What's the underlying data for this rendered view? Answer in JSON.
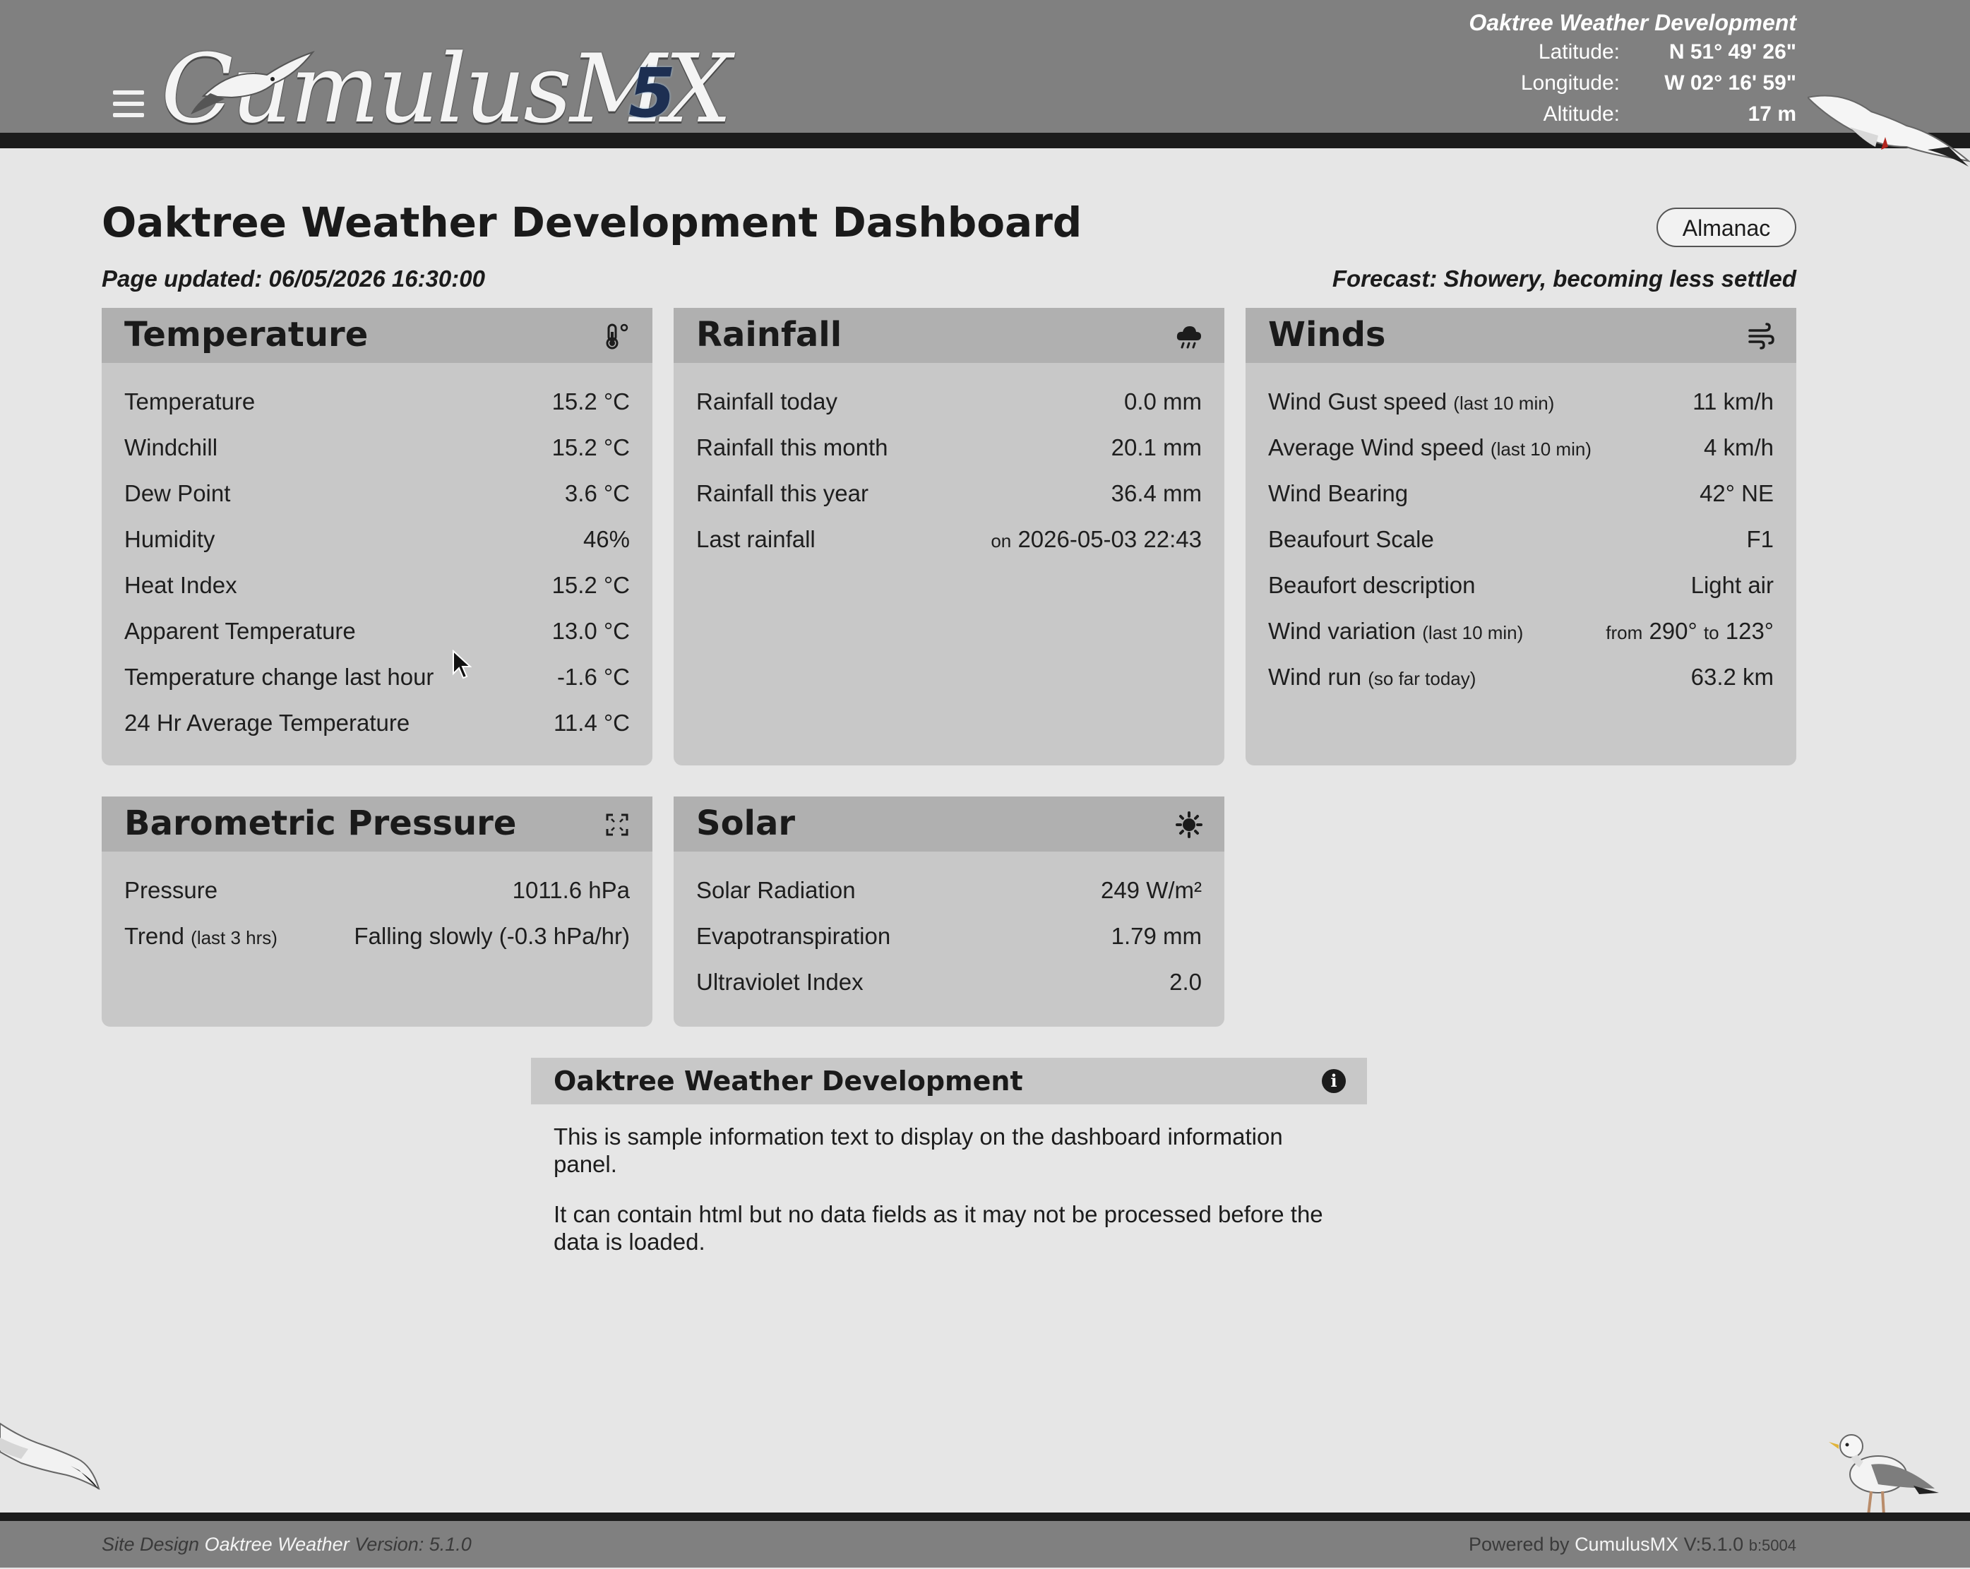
{
  "header": {
    "logo_text": "CumulusMX",
    "logo_version": "5",
    "station_name": "Oaktree Weather Development",
    "location": [
      {
        "label": "Latitude:",
        "value": "N 51° 49' 26\""
      },
      {
        "label": "Longitude:",
        "value": "W 02° 16' 59\""
      },
      {
        "label": "Altitude:",
        "value": "17 m"
      }
    ]
  },
  "page": {
    "title": "Oaktree Weather Development Dashboard",
    "almanac_button": "Almanac",
    "updated": "Page updated: 06/05/2026 16:30:00",
    "forecast": "Forecast: Showery, becoming less settled"
  },
  "temperature": {
    "title": "Temperature",
    "icon": "thermometer-icon",
    "rows": [
      {
        "label": "Temperature",
        "value": "15.2 °C"
      },
      {
        "label": "Windchill",
        "value": "15.2 °C"
      },
      {
        "label": "Dew Point",
        "value": "3.6 °C"
      },
      {
        "label": "Humidity",
        "value": "46%"
      },
      {
        "label": "Heat Index",
        "value": "15.2 °C"
      },
      {
        "label": "Apparent Temperature",
        "value": "13.0 °C"
      },
      {
        "label": "Temperature change last hour",
        "value": "-1.6 °C"
      },
      {
        "label": "24 Hr Average Temperature",
        "value": "11.4 °C"
      }
    ]
  },
  "rainfall": {
    "title": "Rainfall",
    "icon": "rain-cloud-icon",
    "rows": [
      {
        "label": "Rainfall today",
        "value": "0.0 mm"
      },
      {
        "label": "Rainfall this month",
        "value": "20.1 mm"
      },
      {
        "label": "Rainfall this year",
        "value": "36.4 mm"
      },
      {
        "label": "Last rainfall",
        "prefix": "on",
        "value": "2026-05-03 22:43"
      }
    ]
  },
  "winds": {
    "title": "Winds",
    "icon": "wind-icon",
    "rows": [
      {
        "label": "Wind Gust speed",
        "note": "(last 10 min)",
        "value": "11 km/h"
      },
      {
        "label": "Average Wind speed",
        "note": "(last 10 min)",
        "value": "4 km/h"
      },
      {
        "label": "Wind Bearing",
        "value": "42° NE"
      },
      {
        "label": "Beaufourt Scale",
        "value": "F1"
      },
      {
        "label": "Beaufort description",
        "value": "Light air"
      },
      {
        "label": "Wind variation",
        "note": "(last 10 min)",
        "from_word": "from",
        "from": "290°",
        "to_word": "to",
        "to": "123°"
      },
      {
        "label": "Wind run",
        "note": "(so far today)",
        "value": "63.2 km"
      }
    ]
  },
  "pressure": {
    "title": "Barometric Pressure",
    "icon": "pressure-gauge-icon",
    "rows": [
      {
        "label": "Pressure",
        "value": "1011.6 hPa"
      },
      {
        "label": "Trend",
        "note": "(last 3 hrs)",
        "value": "Falling slowly (-0.3 hPa/hr)"
      }
    ]
  },
  "solar": {
    "title": "Solar",
    "icon": "sun-icon",
    "rows": [
      {
        "label": "Solar Radiation",
        "value": "249 W/m²"
      },
      {
        "label": "Evapotranspiration",
        "value": "1.79 mm"
      },
      {
        "label": "Ultraviolet Index",
        "value": "2.0"
      }
    ]
  },
  "info": {
    "title": "Oaktree Weather Development",
    "icon": "info-icon",
    "paragraphs": [
      "This is sample information text to display on the dashboard information panel.",
      "It can contain html but no data fields as it may not be processed before the data is loaded."
    ]
  },
  "footer": {
    "design_prefix": "Site Design",
    "design_name": "Oaktree Weather",
    "version": "Version: 5.1.0",
    "powered_prefix": "Powered by",
    "powered_name": "CumulusMX",
    "powered_version": "V:5.1.0",
    "powered_build": "b:5004"
  }
}
